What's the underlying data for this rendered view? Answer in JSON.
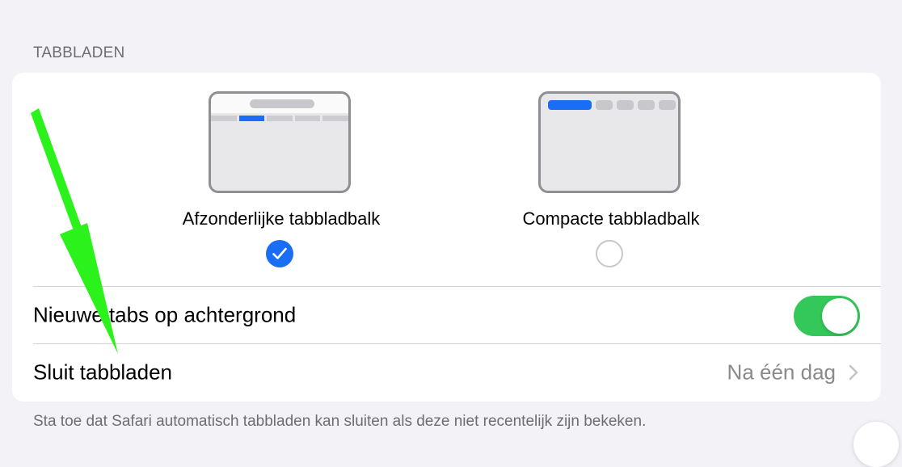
{
  "section": {
    "header": "TABBLADEN",
    "footer": "Sta toe dat Safari automatisch tabbladen kan sluiten als deze niet recentelijk zijn bekeken."
  },
  "layout_options": [
    {
      "label": "Afzonderlijke tabbladbalk",
      "selected": true
    },
    {
      "label": "Compacte tabbladbalk",
      "selected": false
    }
  ],
  "rows": {
    "background_tabs": {
      "label": "Nieuwe tabs op achtergrond",
      "toggle_on": true
    },
    "close_tabs": {
      "label": "Sluit tabbladen",
      "value": "Na één dag"
    }
  },
  "colors": {
    "accent": "#1a6ef5",
    "toggle_on": "#34c759",
    "annotation_arrow": "#2bf21a"
  },
  "icons": {
    "check": "checkmark-icon",
    "chevron": "chevron-right-icon"
  }
}
